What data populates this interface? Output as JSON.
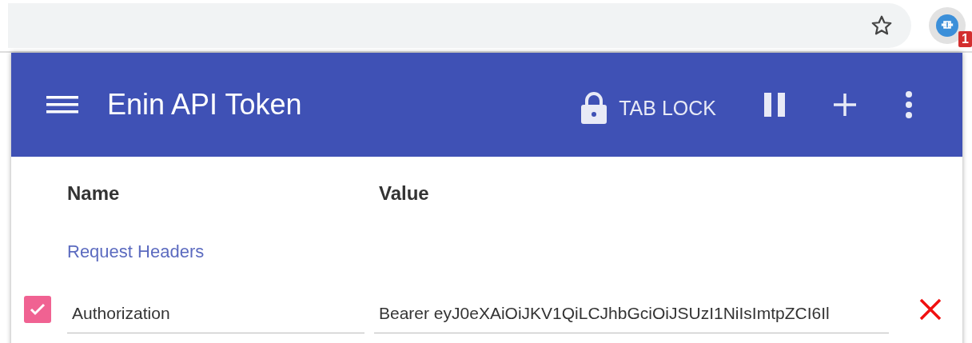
{
  "browser": {
    "extension_badge": "1"
  },
  "header": {
    "title": "Enin API Token",
    "tab_lock": "TAB LOCK"
  },
  "columns": [
    "Name",
    "Value"
  ],
  "section": "Request Headers",
  "rows": [
    {
      "checked": true,
      "name": "Authorization",
      "value": "Bearer eyJ0eXAiOiJKV1QiLCJhbGciOiJSUzI1NiIsImtpZCI6Il"
    }
  ]
}
